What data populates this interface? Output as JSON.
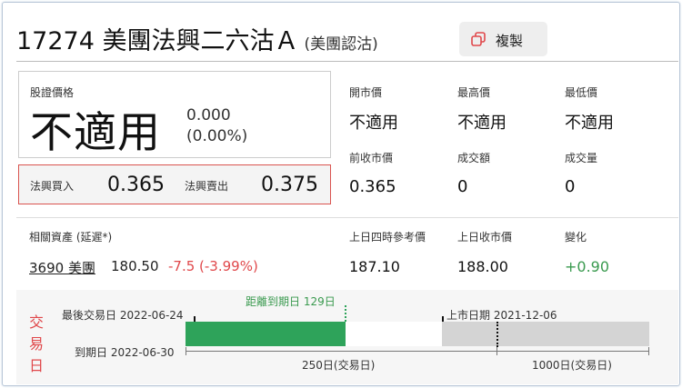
{
  "header": {
    "code_name": "17274 美團法興二六沽Ａ",
    "type_label": "(美團認沽)",
    "copy_label": "複製",
    "copy_icon": "copy-icon"
  },
  "price": {
    "label": "股證價格",
    "value": "不適用",
    "change": "0.000",
    "change_pct": "(0.00%)"
  },
  "bid_ask": {
    "bid_label": "法興買入",
    "bid_value": "0.365",
    "ask_label": "法興賣出",
    "ask_value": "0.375"
  },
  "stats": {
    "open_label": "開市價",
    "open_value": "不適用",
    "high_label": "最高價",
    "high_value": "不適用",
    "low_label": "最低價",
    "low_value": "不適用",
    "prev_close_label": "前收市價",
    "prev_close_value": "0.365",
    "turnover_label": "成交額",
    "turnover_value": "0",
    "volume_label": "成交量",
    "volume_value": "0"
  },
  "underlying": {
    "label": "相關資產 (延遲*)",
    "link": "3690 美團",
    "price": "180.50",
    "change": "-7.5 (-3.99%)",
    "ref_label": "上日四時參考價",
    "ref_value": "187.10",
    "close_label": "上日收市價",
    "close_value": "188.00",
    "diff_label": "變化",
    "diff_value": "+0.90"
  },
  "timeline": {
    "side_label": [
      "交",
      "易",
      "日"
    ],
    "last_trade": "最後交易日 2022-06-24",
    "expiry": "到期日 2022-06-30",
    "days_to_expiry": "距離到期日 129日",
    "listing": "上市日期 2021-12-06",
    "tick_250": "250日(交易日)",
    "tick_1000": "1000日(交易日)"
  },
  "colors": {
    "down": "#e0484b",
    "up": "#3a9a4f",
    "bar_green": "#2ea35a",
    "bar_grey": "#d4d4d4"
  }
}
